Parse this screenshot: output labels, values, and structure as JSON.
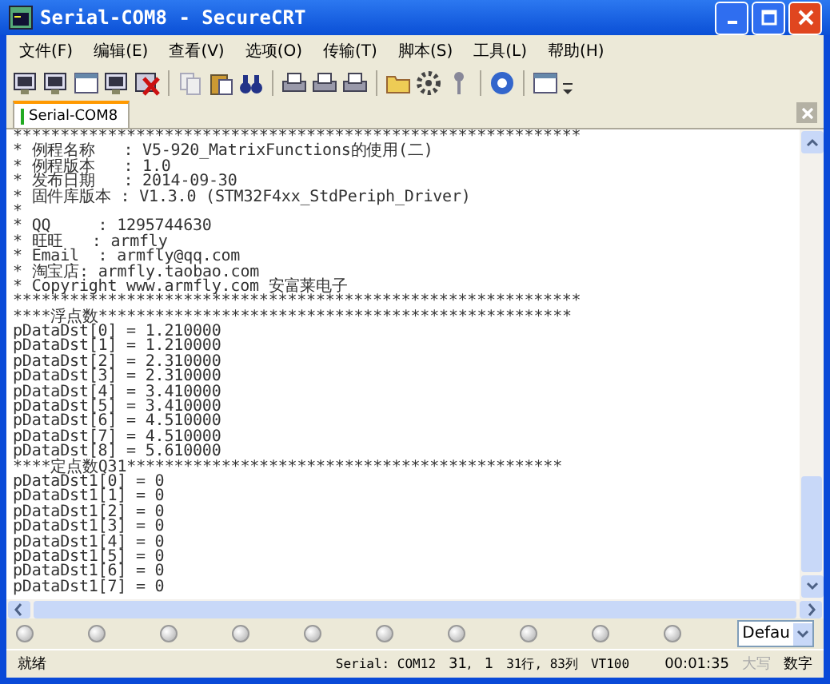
{
  "window": {
    "title": "Serial-COM8 - SecureCRT"
  },
  "menu": [
    "文件(F)",
    "编辑(E)",
    "查看(V)",
    "选项(O)",
    "传输(T)",
    "脚本(S)",
    "工具(L)",
    "帮助(H)"
  ],
  "tabs": [
    {
      "label": "Serial-COM8",
      "selected": true
    }
  ],
  "terminal": {
    "lines": [
      "************************************************************",
      "* 例程名称   : V5-920_MatrixFunctions的使用(二)",
      "* 例程版本   : 1.0",
      "* 发布日期   : 2014-09-30",
      "* 固件库版本 : V1.3.0 (STM32F4xx_StdPeriph_Driver)",
      "*",
      "* QQ     : 1295744630",
      "* 旺旺   : armfly",
      "* Email  : armfly@qq.com",
      "* 淘宝店: armfly.taobao.com",
      "* Copyright www.armfly.com 安富莱电子",
      "************************************************************",
      "****浮点数**************************************************",
      "pDataDst[0] = 1.210000",
      "pDataDst[1] = 1.210000",
      "pDataDst[2] = 2.310000",
      "pDataDst[3] = 2.310000",
      "pDataDst[4] = 3.410000",
      "pDataDst[5] = 3.410000",
      "pDataDst[6] = 4.510000",
      "pDataDst[7] = 4.510000",
      "pDataDst[8] = 5.610000",
      "****定点数Q31**********************************************",
      "pDataDst1[0] = 0",
      "pDataDst1[1] = 0",
      "pDataDst1[2] = 0",
      "pDataDst1[3] = 0",
      "pDataDst1[4] = 0",
      "pDataDst1[5] = 0",
      "pDataDst1[6] = 0",
      "pDataDst1[7] = 0"
    ]
  },
  "button_bar": {
    "session": "Defau"
  },
  "status_bar": [
    {
      "text": "就绪",
      "disabled": false
    },
    {
      "text": "Serial: COM12",
      "disabled": false
    },
    {
      "text": "31,",
      "disabled": false
    },
    {
      "text": "1",
      "disabled": false
    },
    {
      "text": "31行, 83列",
      "disabled": false
    },
    {
      "text": "VT100",
      "disabled": false
    },
    {
      "text": "00:01:35",
      "disabled": false
    },
    {
      "text": "大写",
      "disabled": true
    },
    {
      "text": "数字",
      "disabled": false
    }
  ]
}
